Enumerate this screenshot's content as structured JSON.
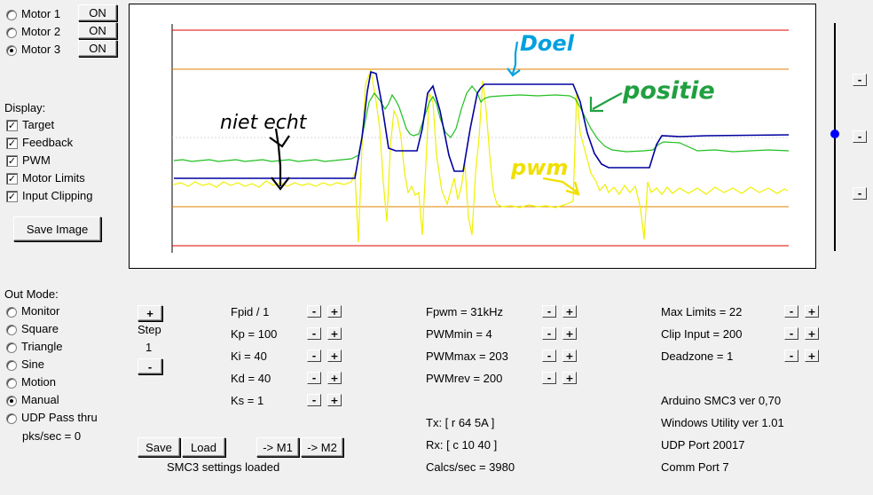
{
  "motors": [
    {
      "label": "Motor 1",
      "button": "ON",
      "selected": false
    },
    {
      "label": "Motor 2",
      "button": "ON",
      "selected": false
    },
    {
      "label": "Motor 3",
      "button": "ON",
      "selected": true
    }
  ],
  "display": {
    "heading": "Display:",
    "items": [
      {
        "label": "Target",
        "checked": true
      },
      {
        "label": "Feedback",
        "checked": true
      },
      {
        "label": "PWM",
        "checked": true
      },
      {
        "label": "Motor Limits",
        "checked": true
      },
      {
        "label": "Input Clipping",
        "checked": true
      }
    ],
    "save_image": "Save Image"
  },
  "graph": {
    "annotations": {
      "doel": "Doel",
      "positie": "positie",
      "pwm": "pwm",
      "niet_echt": "niet echt"
    },
    "colors": {
      "target": "#0000a0",
      "feedback": "#20c020",
      "pwm": "#f0f000",
      "limit_outer": "#e00000",
      "limit_inner": "#e08000",
      "doel_ink": "#00a0e0",
      "positie_ink": "#20a040",
      "pwm_ink": "#f0e000",
      "black_ink": "#000000"
    }
  },
  "slider_buttons": [
    "-",
    "-",
    "-"
  ],
  "out_mode": {
    "heading": "Out Mode:",
    "items": [
      {
        "label": "Monitor",
        "selected": false
      },
      {
        "label": "Square",
        "selected": false
      },
      {
        "label": "Triangle",
        "selected": false
      },
      {
        "label": "Sine",
        "selected": false
      },
      {
        "label": "Motion",
        "selected": false
      },
      {
        "label": "Manual",
        "selected": true
      },
      {
        "label": "UDP Pass thru",
        "selected": false
      }
    ],
    "pks": "pks/sec = 0"
  },
  "step": {
    "plus": "+",
    "label": "Step",
    "value": "1",
    "minus": "-"
  },
  "pid": [
    {
      "label": "Fpid / 1",
      "minus": "-",
      "plus": "+"
    },
    {
      "label": "Kp = 100",
      "minus": "-",
      "plus": "+"
    },
    {
      "label": "Ki = 40",
      "minus": "-",
      "plus": "+"
    },
    {
      "label": "Kd = 40",
      "minus": "-",
      "plus": "+"
    },
    {
      "label": "Ks = 1",
      "minus": "-",
      "plus": "+"
    }
  ],
  "pwm": [
    {
      "label": "Fpwm = 31kHz",
      "minus": "-",
      "plus": "+"
    },
    {
      "label": "PWMmin = 4",
      "minus": "-",
      "plus": "+"
    },
    {
      "label": "PWMmax = 203",
      "minus": "-",
      "plus": "+"
    },
    {
      "label": "PWMrev = 200",
      "minus": "-",
      "plus": "+"
    }
  ],
  "limits": [
    {
      "label": "Max Limits = 22",
      "minus": "-",
      "plus": "+"
    },
    {
      "label": "Clip Input = 200",
      "minus": "-",
      "plus": "+"
    },
    {
      "label": "Deadzone = 1",
      "minus": "-",
      "plus": "+"
    }
  ],
  "comm": {
    "tx": "Tx: [ r 64 5A ]",
    "rx": "Rx: [ c 10 40 ]",
    "calcs": "Calcs/sec = 3980"
  },
  "info": {
    "arduino": "Arduino SMC3 ver 0,70",
    "utility": "Windows Utility ver 1.01",
    "udp": "UDP Port 20017",
    "comm_port": "Comm Port 7"
  },
  "actions": {
    "save": "Save",
    "load": "Load",
    "m1": "-> M1",
    "m2": "-> M2",
    "status": "SMC3 settings loaded"
  }
}
